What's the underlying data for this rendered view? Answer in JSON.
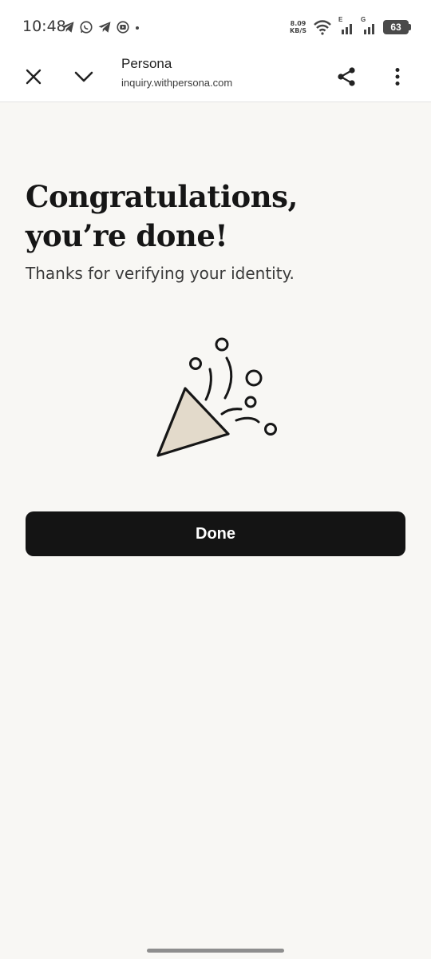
{
  "status_bar": {
    "time": "10:48",
    "net_speed_value": "8.09",
    "net_speed_unit": "KB/S",
    "battery": "63",
    "signal1_label": "E",
    "signal2_label": "G"
  },
  "toolbar": {
    "site_title": "Persona",
    "site_url": "inquiry.withpersona.com"
  },
  "main": {
    "heading": "Congratulations, you’re done!",
    "subtitle": "Thanks for verifying your identity.",
    "done_label": "Done"
  },
  "colors": {
    "background": "#f8f7f4",
    "button": "#141414",
    "cone_fill": "#e3dacb"
  }
}
